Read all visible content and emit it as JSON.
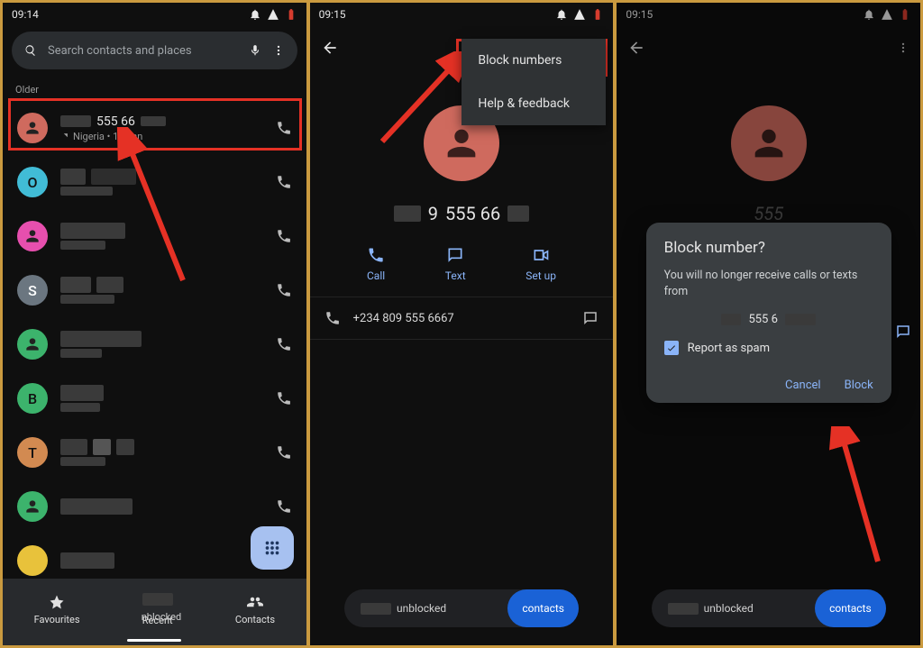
{
  "panel1": {
    "time": "09:14",
    "search_placeholder": "Search contacts and places",
    "section_older": "Older",
    "first_row": {
      "number_frag": "555 66",
      "subtext": "Nigeria • 16 Jan"
    },
    "avatars": [
      "O",
      "",
      "S",
      "",
      "B",
      "T",
      "",
      ""
    ],
    "avatar_colors": [
      "#41bcd6",
      "#e74fae",
      "#6b7680",
      "#3cb36c",
      "#3cb36c",
      "#d28a51",
      "#3cb36c",
      "#e8c23b"
    ],
    "nav": {
      "favourites": "Favourites",
      "recent": "Recent",
      "contacts": "Contacts"
    }
  },
  "panel2": {
    "time": "09:15",
    "menu": {
      "block": "Block numbers",
      "help": "Help & feedback"
    },
    "contact_frag": "555 66",
    "actions": {
      "call": "Call",
      "text": "Text",
      "setup": "Set up"
    },
    "full_number": "+234 809 555 6667",
    "snackbar_text": "unblocked",
    "snackbar_action": "contacts"
  },
  "panel3": {
    "time": "09:15",
    "contact_frag": "555",
    "dialog": {
      "title": "Block number?",
      "body": "You will no longer receive calls or texts from",
      "number_frag": "555 6",
      "spam": "Report as spam",
      "cancel": "Cancel",
      "block": "Block"
    },
    "snackbar_text": "unblocked",
    "snackbar_action": "contacts"
  }
}
